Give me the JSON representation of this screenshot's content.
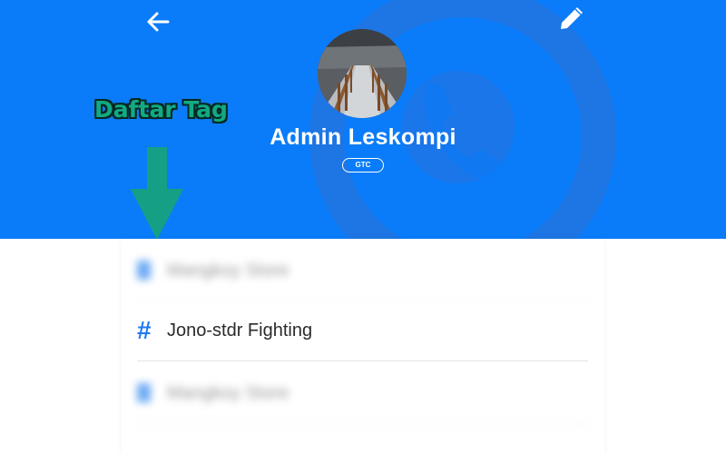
{
  "header": {
    "profile_name": "Admin Leskompi",
    "badge": "GTC",
    "background_color": "#0a7cf9",
    "back_icon": "arrow-left-icon",
    "edit_icon": "pencil-icon"
  },
  "annotation": {
    "label": "Daftar Tag",
    "color": "#12aa84"
  },
  "tags": [
    {
      "label": "Mangkoy Store",
      "blurred": true
    },
    {
      "label": "Jono-stdr Fighting",
      "blurred": false
    },
    {
      "label": "Mangkoy Store",
      "blurred": true
    }
  ]
}
